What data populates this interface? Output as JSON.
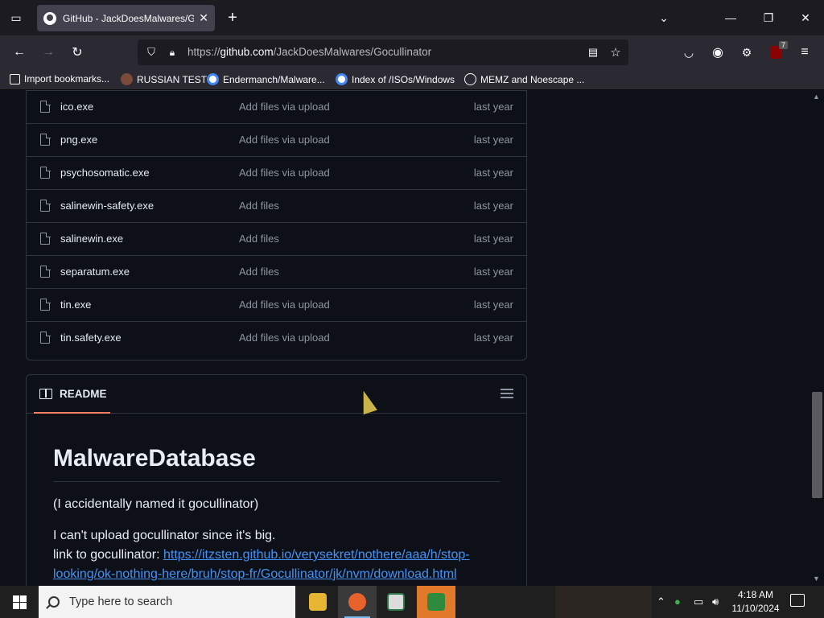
{
  "browser": {
    "tab_title": "GitHub - JackDoesMalwares/Go",
    "url_prefix": "https://",
    "url_domain": "github.com",
    "url_path": "/JackDoesMalwares/Gocullinator",
    "extension_badge": "7"
  },
  "bookmarks": [
    {
      "label": "Import bookmarks...",
      "icon": "import-icon"
    },
    {
      "label": "RUSSIAN TEST",
      "icon": "site-icon"
    },
    {
      "label": "Endermanch/Malware...",
      "icon": "google-icon"
    },
    {
      "label": "Index of /ISOs/Windows",
      "icon": "google-icon"
    },
    {
      "label": "MEMZ and Noescape ...",
      "icon": "globe-icon"
    }
  ],
  "files": [
    {
      "name": "ico.exe",
      "message": "Add files via upload",
      "date": "last year"
    },
    {
      "name": "png.exe",
      "message": "Add files via upload",
      "date": "last year"
    },
    {
      "name": "psychosomatic.exe",
      "message": "Add files via upload",
      "date": "last year"
    },
    {
      "name": "salinewin-safety.exe",
      "message": "Add files",
      "date": "last year"
    },
    {
      "name": "salinewin.exe",
      "message": "Add files",
      "date": "last year"
    },
    {
      "name": "separatum.exe",
      "message": "Add files",
      "date": "last year"
    },
    {
      "name": "tin.exe",
      "message": "Add files via upload",
      "date": "last year"
    },
    {
      "name": "tin.safety.exe",
      "message": "Add files via upload",
      "date": "last year"
    }
  ],
  "readme": {
    "tab_label": "README",
    "title": "MalwareDatabase",
    "para1": "(I accidentally named it gocullinator)",
    "para2": "I can't upload gocullinator since it's big.",
    "link_prefix": "link to gocullinator: ",
    "link_line1": "https://itzsten.github.io/verysekret/nothere/aaa/h/stop-",
    "link_line2": "looking/ok-nothing-here/bruh/stop-fr/Gocullinator/jk/nvm/download.html"
  },
  "taskbar": {
    "search_placeholder": "Type here to search",
    "time": "4:18 AM",
    "date": "11/10/2024",
    "apps": [
      "file-explorer-icon",
      "firefox-icon",
      "news-icon",
      "game-app-icon"
    ]
  },
  "colors": {
    "link": "#4493f8",
    "accent_underline": "#f78166",
    "page_bg": "#0d1117"
  }
}
